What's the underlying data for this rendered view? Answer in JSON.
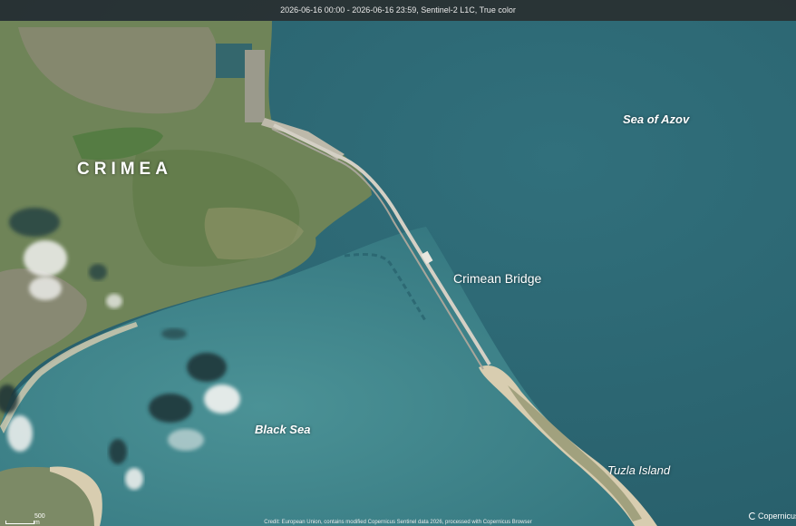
{
  "header": {
    "caption": "2026-06-16 00:00 - 2026-06-16 23:59, Sentinel-2 L1C, True color"
  },
  "labels": {
    "sea_of_azov": "Sea of Azov",
    "crimea": "CRIMEA",
    "crimean_bridge": "Crimean Bridge",
    "black_sea": "Black Sea",
    "tuzla_island": "Tuzla Island"
  },
  "footer": {
    "scale": "500 m",
    "credit": "Credit: European Union, contains modified Copernicus Sentinel data 2026, processed with Copernicus Browser",
    "logo": "Copernicus"
  },
  "colors": {
    "sea_azov": "#2f6b77",
    "sea_black": "#3a7f86",
    "land": "#6f8458",
    "urban": "#8e8a7a",
    "sand": "#d8cdb0",
    "cloud": "#f2f2f0"
  }
}
